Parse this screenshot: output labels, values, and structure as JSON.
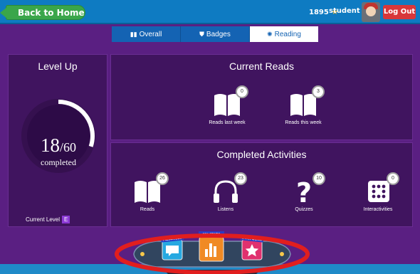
{
  "header": {
    "back_label": "Back to Home",
    "points": "1895",
    "username": "student 1",
    "logout_label": "Log Out"
  },
  "tabs": [
    {
      "label": "Overall",
      "icon": "bar-chart-icon",
      "active": false
    },
    {
      "label": "Badges",
      "icon": "shield-icon",
      "active": false
    },
    {
      "label": "Reading",
      "icon": "gear-icon",
      "active": true
    }
  ],
  "level_up": {
    "title": "Level Up",
    "current": "18",
    "total": "/60",
    "completed_label": "completed",
    "progress": 0.3,
    "current_level_label": "Current Level",
    "current_level": "E"
  },
  "current_reads": {
    "title": "Current Reads",
    "items": [
      {
        "label": "Reads last week",
        "count": "0",
        "icon": "book-icon"
      },
      {
        "label": "Reads this week",
        "count": "3",
        "icon": "book-icon"
      }
    ]
  },
  "completed_activities": {
    "title": "Completed Activities",
    "items": [
      {
        "label": "Reads",
        "count": "26",
        "icon": "book-icon"
      },
      {
        "label": "Listens",
        "count": "23",
        "icon": "headphones-icon"
      },
      {
        "label": "Quizzes",
        "count": "10",
        "icon": "question-icon"
      },
      {
        "label": "Interactivities",
        "count": "0",
        "icon": "dice-icon"
      }
    ]
  },
  "dock": {
    "items": [
      {
        "label": "MESSAGES",
        "icon": "message-icon"
      },
      {
        "label": "MY STATS",
        "icon": "bar-chart-icon"
      },
      {
        "label": "STAR ZONE",
        "icon": "star-icon"
      }
    ]
  },
  "colors": {
    "topbar": "#0e7bc2",
    "background": "#5a1f82",
    "panel": "#40145f",
    "back_button": "#3aa64a",
    "logout_button": "#d8373a",
    "tab_active": "#ffffff",
    "tab": "#1463b3",
    "highlight_ellipse": "#e11e1e"
  }
}
